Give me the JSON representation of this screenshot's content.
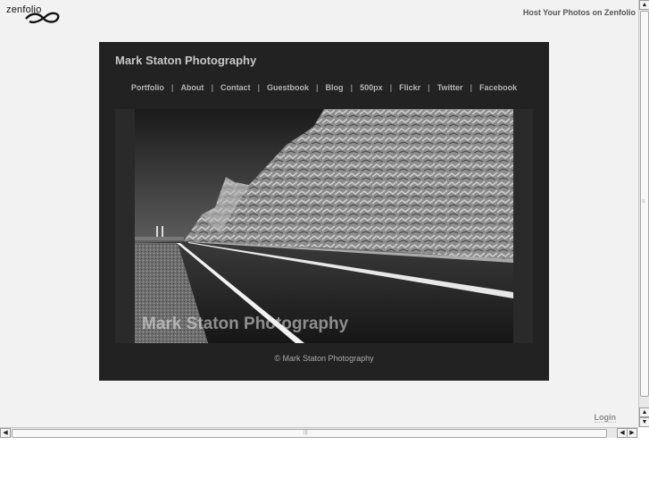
{
  "header": {
    "logo_text": "zenfolio",
    "host_link": "Host Your Photos on Zenfolio"
  },
  "site": {
    "title": "Mark Staton Photography",
    "nav": [
      "Portfolio",
      "About",
      "Contact",
      "Guestbook",
      "Blog",
      "500px",
      "Flickr",
      "Twitter",
      "Facebook"
    ],
    "nav_separator": "|",
    "photo_watermark": "Mark Staton Photography",
    "copyright": "© Mark Staton Photography"
  },
  "footer": {
    "login": "Login"
  },
  "scrollbars": {
    "up_arrow": "▲",
    "down_arrow": "▼",
    "left_arrow": "◀",
    "right_arrow": "▶"
  }
}
